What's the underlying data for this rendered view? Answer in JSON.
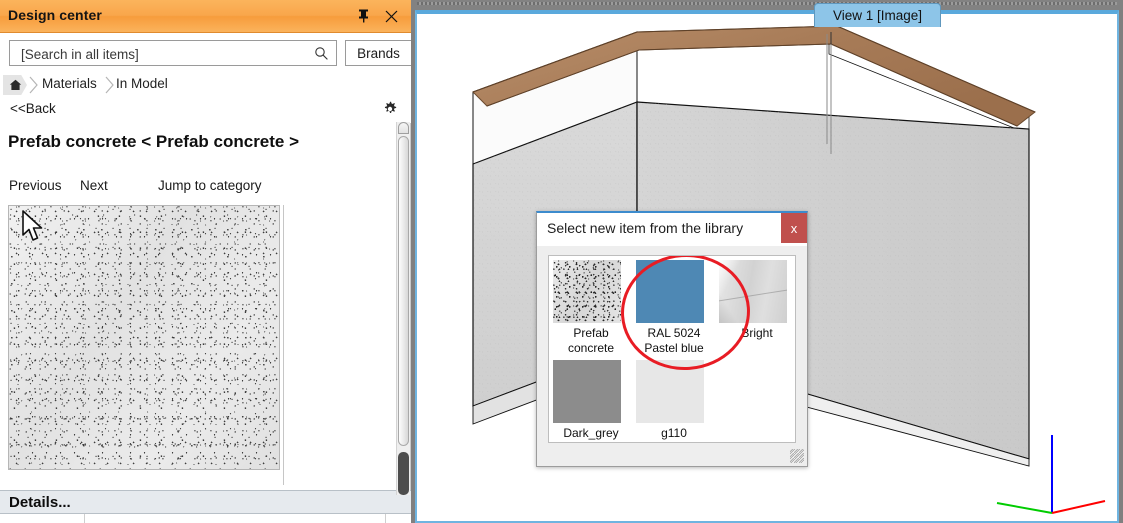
{
  "panel": {
    "title": "Design center",
    "pin_icon": "pin-icon",
    "close_icon": "close-icon",
    "search": {
      "value": "",
      "placeholder": "[Search in all items]",
      "icon": "search-icon"
    },
    "brands_button": "Brands",
    "breadcrumb": {
      "home_icon": "home-icon",
      "items": [
        "Materials",
        "In Model"
      ]
    },
    "back_link": "<<Back",
    "settings_icon": "gear-icon",
    "heading_main": "Prefab concrete",
    "heading_secondary": "< Prefab concrete >",
    "nav": {
      "previous": "Previous",
      "next": "Next",
      "jump": "Jump to category"
    },
    "preview": {
      "material": "Prefab concrete",
      "cursor_icon": "mouse-pointer-icon"
    },
    "details_label": "Details...",
    "scrollbar": {
      "up_arrow_icon": "scroll-up-icon"
    }
  },
  "viewport": {
    "tab_label": "View 1 [Image]",
    "axes": {
      "x_color": "#ff0000",
      "y_color": "#00cc00",
      "z_color": "#0000ff"
    },
    "model": {
      "wall_material": "concrete",
      "beam_material": "wood"
    }
  },
  "dialog": {
    "title": "Select new item from the library",
    "close_label": "x",
    "close_color": "#c0504d",
    "accent_color": "#3c8bcd",
    "highlight_color": "#e81c24",
    "highlighted_item": "RAL 5024 Pastel blue",
    "items": [
      {
        "label_line1": "Prefab",
        "label_line2": "concrete",
        "swatch": "texture-concrete",
        "color": ""
      },
      {
        "label_line1": "RAL 5024",
        "label_line2": "Pastel blue",
        "swatch": "solid",
        "color": "#4e88b4"
      },
      {
        "label_line1": "Bright",
        "label_line2": "",
        "swatch": "texture-bright",
        "color": ""
      },
      {
        "label_line1": "Dark_grey",
        "label_line2": "",
        "swatch": "solid",
        "color": "#8c8c8c"
      },
      {
        "label_line1": "g110",
        "label_line2": "",
        "swatch": "solid",
        "color": "#e7e7e7"
      }
    ],
    "resize_grip_icon": "resize-grip-icon"
  },
  "colors": {
    "panel_title_bg": "#f9a64b",
    "viewport_border": "#6fb4e0",
    "tab_bg": "#8dc5e8"
  }
}
